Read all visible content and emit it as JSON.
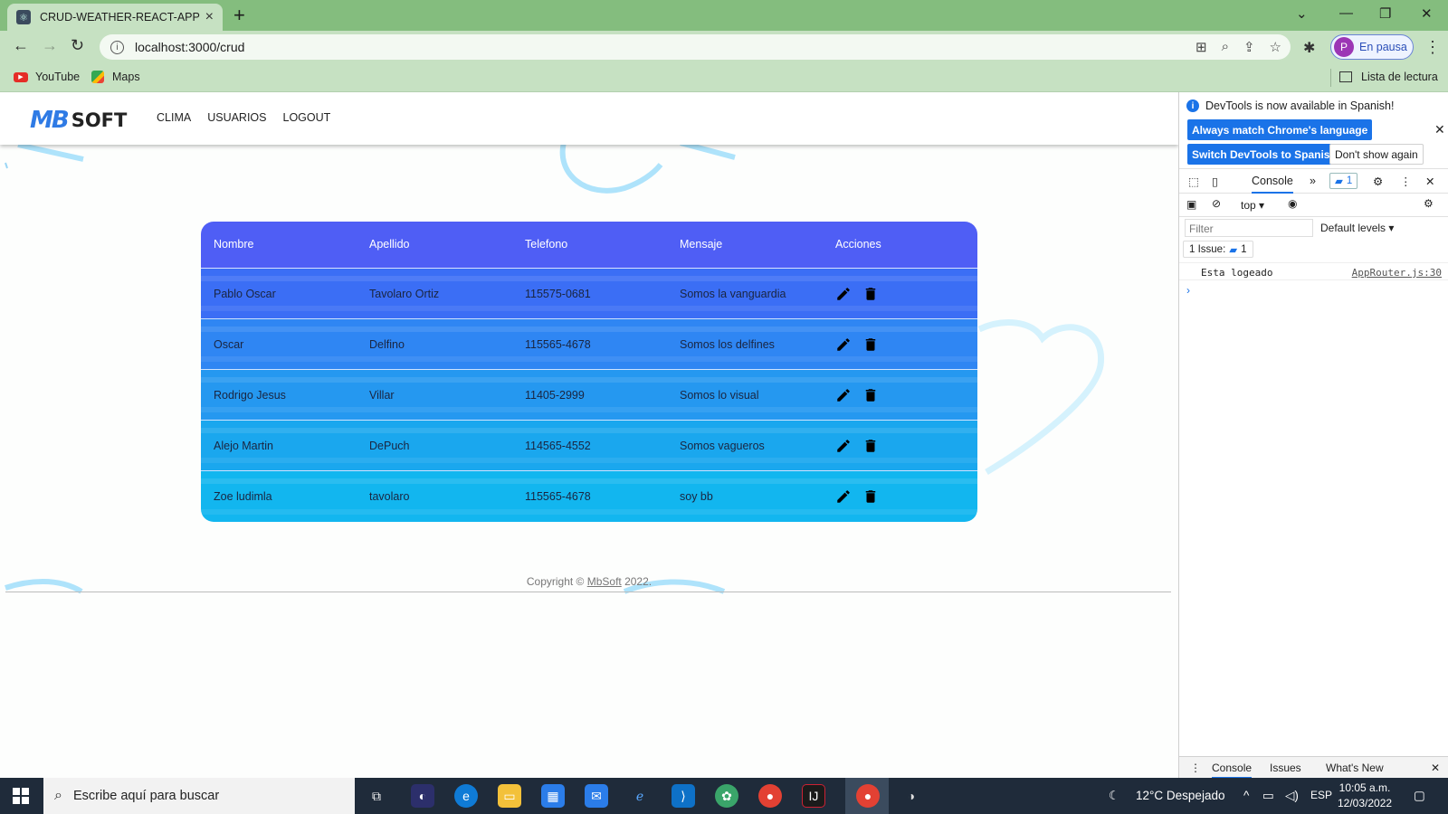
{
  "browser": {
    "tab_title": "CRUD-WEATHER-REACT-APP",
    "url": "localhost:3000/crud",
    "profile_initial": "P",
    "profile_label": "En pausa",
    "bookmarks": [
      "YouTube",
      "Maps"
    ],
    "reading_list": "Lista de lectura"
  },
  "app": {
    "logo_mark": "MB",
    "logo_word": "SOFT",
    "nav": [
      "CLIMA",
      "USUARIOS",
      "LOGOUT"
    ],
    "table": {
      "headers": [
        "Nombre",
        "Apellido",
        "Telefono",
        "Mensaje",
        "Acciones"
      ],
      "rows": [
        [
          "Pablo Oscar",
          "Tavolaro Ortiz",
          "115575-0681",
          "Somos la vanguardia"
        ],
        [
          "Oscar",
          "Delfino",
          "115565-4678",
          "Somos los delfines"
        ],
        [
          "Rodrigo Jesus",
          "Villar",
          "11405-2999",
          "Somos lo visual"
        ],
        [
          "Alejo Martin",
          "DePuch",
          "114565-4552",
          "Somos vagueros"
        ],
        [
          "Zoe ludimla",
          "tavolaro",
          "115565-4678",
          "soy bb"
        ]
      ]
    },
    "footer_prefix": "Copyright © ",
    "footer_link": "MbSoft",
    "footer_year": " 2022."
  },
  "devtools": {
    "notice": "DevTools is now available in Spanish!",
    "btn_match": "Always match Chrome's language",
    "btn_switch": "Switch DevTools to Spanish",
    "btn_dont_show": "Don't show again",
    "tab_console": "Console",
    "badge_count": "1",
    "context": "top",
    "filter_placeholder": "Filter",
    "levels": "Default levels",
    "issues_label": "1 Issue:",
    "issues_count": "1",
    "log_message": "Esta logeado",
    "log_source": "AppRouter.js:30",
    "drawer_tabs": [
      "Console",
      "Issues",
      "What's New"
    ]
  },
  "taskbar": {
    "search_placeholder": "Escribe aquí para buscar",
    "weather": "12°C  Despejado",
    "lang": "ESP",
    "time": "10:05 a.m.",
    "date": "12/03/2022"
  },
  "colors": {
    "header_blue": "#4f5ef5",
    "row_gradient": [
      "#3b6ef5",
      "#2f86f3",
      "#2598f0",
      "#1aa7ee",
      "#12b6ef"
    ],
    "chrome_green": "#84bd7e"
  }
}
